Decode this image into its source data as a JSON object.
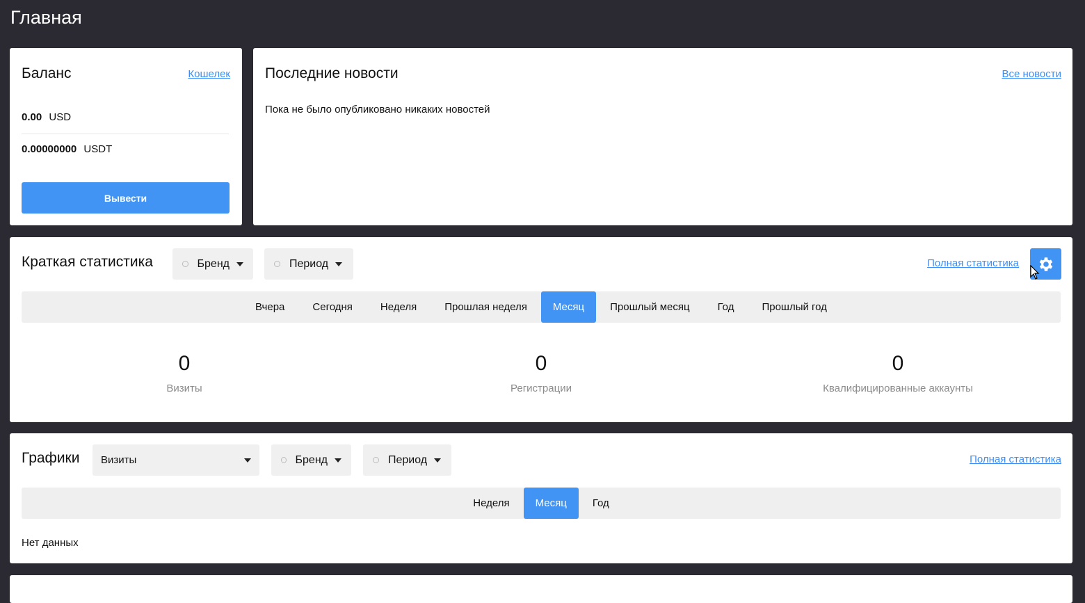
{
  "page": {
    "title": "Главная"
  },
  "balance": {
    "title": "Баланс",
    "wallet_link": "Кошелек",
    "rows": [
      {
        "amount": "0.00",
        "currency": "USD"
      },
      {
        "amount": "0.00000000",
        "currency": "USDT"
      }
    ],
    "withdraw_label": "Вывести"
  },
  "news": {
    "title": "Последние новости",
    "all_link": "Все новости",
    "empty_text": "Пока не было опубликовано никаких новостей"
  },
  "stats": {
    "title": "Краткая статистика",
    "brand_filter": "Бренд",
    "period_filter": "Период",
    "full_link": "Полная статистика",
    "tabs": [
      "Вчера",
      "Сегодня",
      "Неделя",
      "Прошлая неделя",
      "Месяц",
      "Прошлый месяц",
      "Год",
      "Прошлый год"
    ],
    "active_tab": "Месяц",
    "metrics": [
      {
        "value": "0",
        "label": "Визиты"
      },
      {
        "value": "0",
        "label": "Регистрации"
      },
      {
        "value": "0",
        "label": "Квалифицированные аккаунты"
      }
    ]
  },
  "charts": {
    "title": "Графики",
    "metric_select": "Визиты",
    "brand_filter": "Бренд",
    "period_filter": "Период",
    "full_link": "Полная статистика",
    "tabs": [
      "Неделя",
      "Месяц",
      "Год"
    ],
    "active_tab": "Месяц",
    "empty_text": "Нет данных"
  },
  "colors": {
    "accent": "#4193f4",
    "background": "#2b2a33",
    "link": "#3d8ef4"
  }
}
